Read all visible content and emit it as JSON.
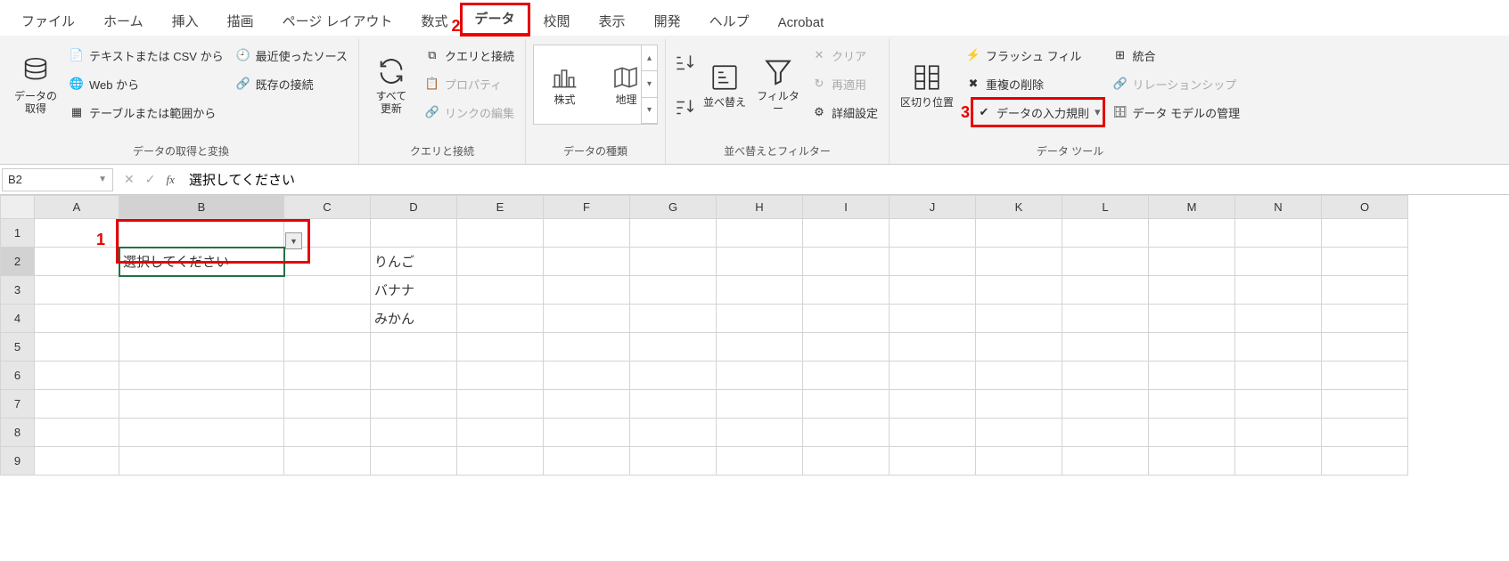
{
  "menu": {
    "tabs": [
      "ファイル",
      "ホーム",
      "挿入",
      "描画",
      "ページ レイアウト",
      "数式",
      "データ",
      "校閲",
      "表示",
      "開発",
      "ヘルプ",
      "Acrobat"
    ],
    "active_index": 6,
    "annotation_2": "2"
  },
  "ribbon": {
    "group1": {
      "label": "データの取得と変換",
      "big": "データの\n取得",
      "items": [
        "テキストまたは CSV から",
        "Web から",
        "テーブルまたは範囲から",
        "最近使ったソース",
        "既存の接続"
      ]
    },
    "group2": {
      "label": "クエリと接続",
      "big": "すべて\n更新",
      "items": [
        "クエリと接続",
        "プロパティ",
        "リンクの編集"
      ]
    },
    "group3": {
      "label": "データの種類",
      "items": [
        "株式",
        "地理"
      ]
    },
    "group4": {
      "label": "並べ替えとフィルター",
      "sort": "並べ替え",
      "filter": "フィルター",
      "clear": "クリア",
      "reapply": "再適用",
      "advanced": "詳細設定"
    },
    "group5": {
      "label": "データ ツール",
      "split": "区切り位置",
      "flash": "フラッシュ フィル",
      "dup": "重複の削除",
      "validation": "データの入力規則",
      "consolidate": "統合",
      "relation": "リレーションシップ",
      "model": "データ モデルの管理",
      "annotation_3": "3"
    }
  },
  "formula": {
    "namebox": "B2",
    "content": "選択してください"
  },
  "grid": {
    "columns": [
      "A",
      "B",
      "C",
      "D",
      "E",
      "F",
      "G",
      "H",
      "I",
      "J",
      "K",
      "L",
      "M",
      "N",
      "O"
    ],
    "rows": [
      1,
      2,
      3,
      4,
      5,
      6,
      7,
      8,
      9
    ],
    "b2": "選択してください",
    "d2": "りんご",
    "d3": "バナナ",
    "d4": "みかん",
    "annotation_1": "1"
  }
}
